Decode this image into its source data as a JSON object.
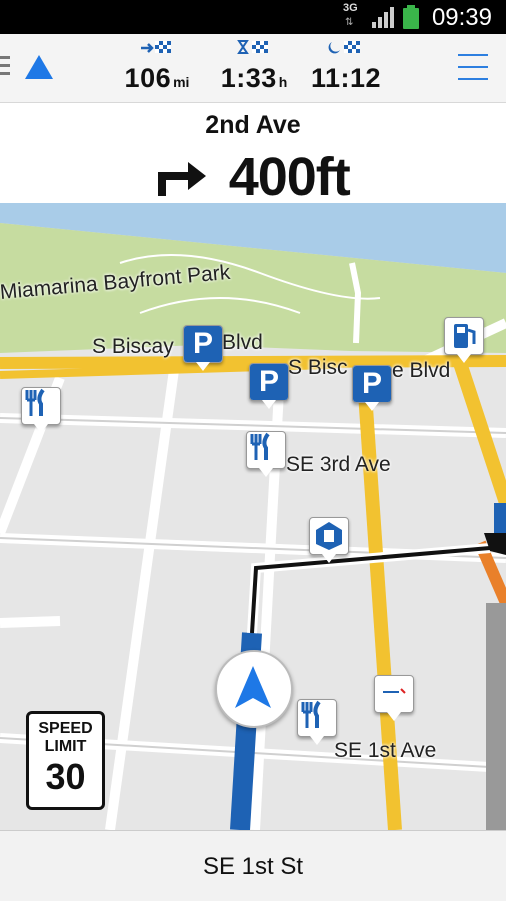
{
  "status_bar": {
    "time": "09:39",
    "network": "3G",
    "signal_icon": "signal-bars-icon",
    "battery_icon": "battery-icon",
    "battery_color": "#3ab54a"
  },
  "trip": {
    "distance": {
      "value": "106",
      "unit": "mi",
      "icon": "distance-to-destination-icon"
    },
    "time_remaining": {
      "value": "1:33",
      "unit": "h",
      "icon": "time-to-destination-icon"
    },
    "arrival": {
      "value": "11:12",
      "unit": "",
      "icon": "arrival-time-icon"
    }
  },
  "instruction": {
    "street": "2nd Ave",
    "distance": "400ft",
    "turn_icon": "turn-right-icon"
  },
  "map": {
    "labels": {
      "park": "Miamarina Bayfront Park",
      "biscayne_left": "S Biscay",
      "biscayne_left2": "Blvd",
      "biscayne_right": "S Bisc",
      "biscayne_right2": "e Blvd",
      "se3rd": "SE 3rd Ave",
      "se1st": "SE 1st Ave"
    },
    "route_color": "#1e62b4",
    "major_road_color": "#f2c230",
    "park_color": "#c6dca0",
    "water_color": "#a9cce8"
  },
  "speed_limit": {
    "label_line1": "SPEED",
    "label_line2": "LIMIT",
    "value": "30"
  },
  "bottom": {
    "current_street": "SE 1st St"
  }
}
